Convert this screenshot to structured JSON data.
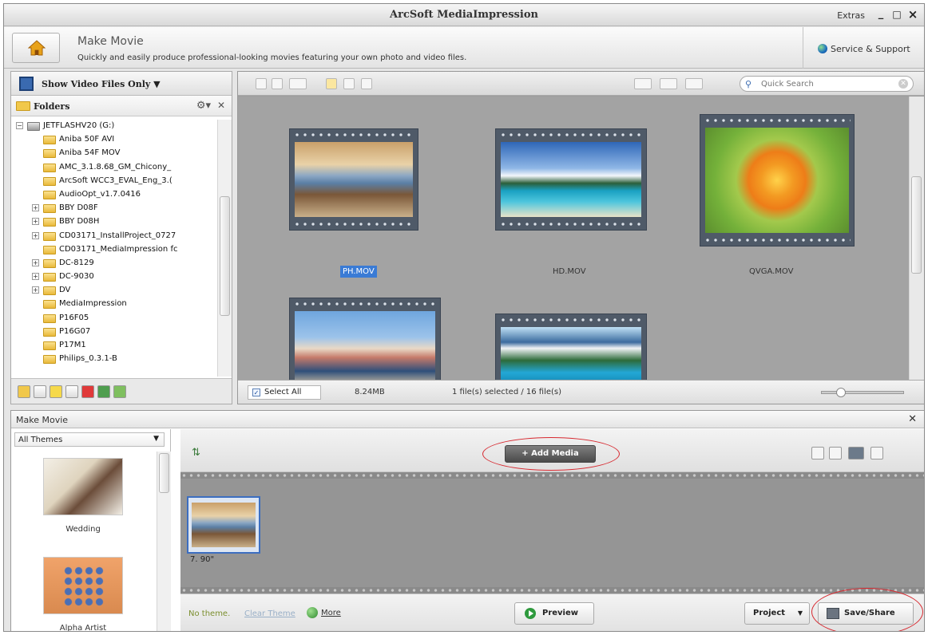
{
  "window": {
    "title": "ArcSoft MediaImpression",
    "extras_label": "Extras",
    "minimize": "_",
    "maximize": "□",
    "close": "×"
  },
  "header": {
    "title": "Make Movie",
    "subtitle": "Quickly and easily produce professional-looking movies featuring your own photo and video files.",
    "support_label": "Service & Support",
    "home_icon": "home-icon"
  },
  "left": {
    "filter_label": "Show Video Files Only",
    "folders_label": "Folders",
    "tree": [
      {
        "label": "JETFLASHV20 (G:)",
        "depth": 0,
        "expand": "−",
        "type": "drive"
      },
      {
        "label": "Aniba 50F AVI",
        "depth": 1,
        "expand": "",
        "type": "folder"
      },
      {
        "label": "Aniba 54F MOV",
        "depth": 1,
        "expand": "",
        "type": "folder"
      },
      {
        "label": "AMC_3.1.8.68_GM_Chicony_",
        "depth": 1,
        "expand": "",
        "type": "folder"
      },
      {
        "label": "ArcSoft WCC3_EVAL_Eng_3.(",
        "depth": 1,
        "expand": "",
        "type": "folder"
      },
      {
        "label": "AudioOpt_v1.7.0416",
        "depth": 1,
        "expand": "",
        "type": "folder"
      },
      {
        "label": "BBY D08F",
        "depth": 1,
        "expand": "+",
        "type": "folder"
      },
      {
        "label": "BBY D08H",
        "depth": 1,
        "expand": "+",
        "type": "folder"
      },
      {
        "label": "CD03171_InstallProject_0727",
        "depth": 1,
        "expand": "+",
        "type": "folder"
      },
      {
        "label": "CD03171_MediaImpression fc",
        "depth": 1,
        "expand": "",
        "type": "folder"
      },
      {
        "label": "DC-8129",
        "depth": 1,
        "expand": "+",
        "type": "folder"
      },
      {
        "label": "DC-9030",
        "depth": 1,
        "expand": "+",
        "type": "folder"
      },
      {
        "label": "DV",
        "depth": 1,
        "expand": "+",
        "type": "folder"
      },
      {
        "label": "MediaImpression",
        "depth": 1,
        "expand": "",
        "type": "folder"
      },
      {
        "label": "P16F05",
        "depth": 1,
        "expand": "",
        "type": "folder"
      },
      {
        "label": "P16G07",
        "depth": 1,
        "expand": "",
        "type": "folder"
      },
      {
        "label": "P17M1",
        "depth": 1,
        "expand": "",
        "type": "folder"
      },
      {
        "label": "Philips_0.3.1-B",
        "depth": 1,
        "expand": "",
        "type": "folder"
      }
    ]
  },
  "browser": {
    "search_placeholder": "Quick Search",
    "files": [
      {
        "name": "PH.MOV",
        "selected": true
      },
      {
        "name": "HD.MOV",
        "selected": false
      },
      {
        "name": "QVGA.MOV",
        "selected": false
      },
      {
        "name": "",
        "selected": false
      },
      {
        "name": "",
        "selected": false
      }
    ],
    "select_all_label": "Select All",
    "size_text": "8.24MB",
    "selection_text": "1 file(s) selected / 16 file(s)",
    "zoom_level": 0.2
  },
  "movie": {
    "panel_title": "Make Movie",
    "theme_filter": "All Themes",
    "themes": [
      {
        "label": "Wedding"
      },
      {
        "label": "Alpha Artist"
      }
    ],
    "add_media_label": "Add Media",
    "clip_duration": "7. 90\"",
    "no_theme_label": "No theme.",
    "clear_theme_label": "Clear Theme",
    "more_label": "More",
    "preview_label": "Preview",
    "project_label": "Project",
    "save_share_label": "Save/Share"
  },
  "colors": {
    "highlight": "#d7282f",
    "selection": "#3a7bd5"
  }
}
